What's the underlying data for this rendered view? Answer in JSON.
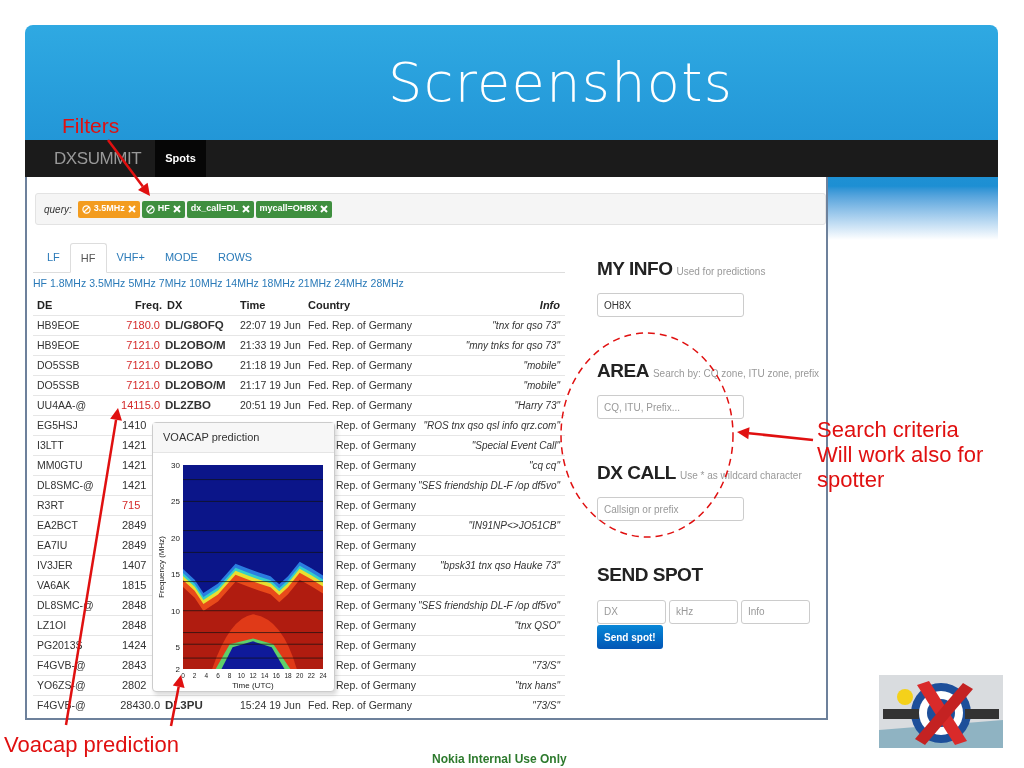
{
  "slide": {
    "title": "Screenshots",
    "filters_note": "Filters",
    "search_note": [
      "Search criteria",
      "Will work also for",
      "spotter"
    ],
    "voacap_note": "Voacap prediction",
    "footer": "Nokia Internal Use Only"
  },
  "app": {
    "brand": "DXSUMMIT",
    "nav": [
      {
        "label": "Spots",
        "selected": true
      }
    ],
    "query": {
      "label": "query:",
      "tags": [
        {
          "label": "3.5MHz",
          "color": "#f39c1f",
          "negated": true
        },
        {
          "label": "HF",
          "color": "#3f8f3f",
          "negated": true
        },
        {
          "label": "dx_call=DL",
          "color": "#3f8f3f",
          "negated": false
        },
        {
          "label": "mycall=OH8X",
          "color": "#3f8f3f",
          "negated": false
        }
      ]
    },
    "tabs": [
      {
        "label": "LF",
        "selected": false
      },
      {
        "label": "HF",
        "selected": true
      },
      {
        "label": "VHF+",
        "selected": false
      },
      {
        "label": "MODE",
        "selected": false
      },
      {
        "label": "ROWS",
        "selected": false
      }
    ],
    "bands": [
      "HF",
      "1.8MHz",
      "3.5MHz",
      "5MHz",
      "7MHz",
      "10MHz",
      "14MHz",
      "18MHz",
      "21MHz",
      "24MHz",
      "28MHz"
    ],
    "table": {
      "columns": [
        "DE",
        "Freq.",
        "DX",
        "Time",
        "Country",
        "Info"
      ],
      "rows": [
        {
          "de": "HB9EOE",
          "freq": "7180.0",
          "color": "#d42a2a",
          "covered": false,
          "dx": "DL/G8OFQ",
          "time": "22:07 19 Jun",
          "country": "Fed. Rep. of Germany",
          "info": "\"tnx for qso 73\""
        },
        {
          "de": "HB9EOE",
          "freq": "7121.0",
          "color": "#d42a2a",
          "covered": false,
          "dx": "DL2OBO/M",
          "time": "21:33 19 Jun",
          "country": "Fed. Rep. of Germany",
          "info": "\"mny tnks for qso 73\""
        },
        {
          "de": "DO5SSB",
          "freq": "7121.0",
          "color": "#d42a2a",
          "covered": false,
          "dx": "DL2OBO",
          "time": "21:18 19 Jun",
          "country": "Fed. Rep. of Germany",
          "info": "\"mobile\""
        },
        {
          "de": "DO5SSB",
          "freq": "7121.0",
          "color": "#d42a2a",
          "covered": false,
          "dx": "DL2OBO/M",
          "time": "21:17 19 Jun",
          "country": "Fed. Rep. of Germany",
          "info": "\"mobile\""
        },
        {
          "de": "UU4AA-@",
          "freq": "14115.0",
          "color": "#d42a2a",
          "covered": false,
          "dx": "DL2ZBO",
          "time": "20:51 19 Jun",
          "country": "Fed. Rep. of Germany",
          "info": "\"Harry 73\""
        },
        {
          "de": "EG5HSJ",
          "freq": "1410",
          "color": "#333333",
          "covered": true,
          "country": "Rep. of Germany",
          "info": "\"ROS tnx qso qsl info qrz.com\""
        },
        {
          "de": "I3LTT",
          "freq": "1421",
          "color": "#333333",
          "covered": true,
          "country": "Rep. of Germany",
          "info": "\"Special Event Call\""
        },
        {
          "de": "MM0GTU",
          "freq": "1421",
          "color": "#333333",
          "covered": true,
          "country": "Rep. of Germany",
          "info": "\"cq cq\""
        },
        {
          "de": "DL8SMC-@",
          "freq": "1421",
          "color": "#333333",
          "covered": true,
          "country": "Rep. of Germany",
          "info": "\"SES friendship DL-F /op df5vo\""
        },
        {
          "de": "R3RT",
          "freq": "715",
          "color": "#d42a2a",
          "covered": true,
          "country": "Rep. of Germany"
        },
        {
          "de": "EA2BCT",
          "freq": "2849",
          "color": "#333333",
          "covered": true,
          "country": "Rep. of Germany",
          "info": "\"IN91NP<>JO51CB\""
        },
        {
          "de": "EA7IU",
          "freq": "2849",
          "color": "#333333",
          "covered": true,
          "country": "Rep. of Germany"
        },
        {
          "de": "IV3JER",
          "freq": "1407",
          "color": "#333333",
          "covered": true,
          "country": "Rep. of Germany",
          "info": "\"bpsk31 tnx qso Hauke 73\""
        },
        {
          "de": "VA6AK",
          "freq": "1815",
          "color": "#333333",
          "covered": true,
          "country": "Rep. of Germany"
        },
        {
          "de": "DL8SMC-@",
          "freq": "2848",
          "color": "#333333",
          "covered": true,
          "country": "Rep. of Germany",
          "info": "\"SES friendship DL-F /op df5vo\""
        },
        {
          "de": "LZ1OI",
          "freq": "2848",
          "color": "#333333",
          "covered": true,
          "country": "Rep. of Germany",
          "info": "\"tnx QSO\""
        },
        {
          "de": "PG2013S",
          "freq": "1424",
          "color": "#333333",
          "covered": true,
          "country": "Rep. of Germany"
        },
        {
          "de": "F4GVB-@",
          "freq": "2843",
          "color": "#333333",
          "covered": true,
          "country": "Rep. of Germany",
          "info": "\"73/S\""
        },
        {
          "de": "YO6ZS-@",
          "freq": "2802",
          "color": "#333333",
          "covered": true,
          "country": "Rep. of Germany",
          "info": "\"tnx hans\""
        },
        {
          "de": "F4GVB-@",
          "freq": "28430.0",
          "color": "#333333",
          "covered": false,
          "dx": "DL3PU",
          "time": "15:24 19 Jun",
          "country": "Fed. Rep. of Germany",
          "info": "\"73/S\""
        }
      ]
    },
    "popover": {
      "title": "VOACAP prediction",
      "xlabel": "Time (UTC)",
      "ylabel": "Frequency (MHz)",
      "xticks": [
        "0",
        "2",
        "4",
        "6",
        "8",
        "10",
        "12",
        "14",
        "16",
        "18",
        "20",
        "22",
        "24"
      ],
      "yticks": [
        "30",
        "25",
        "20",
        "15",
        "10",
        "5",
        "2"
      ]
    },
    "sidebar": {
      "sections": [
        {
          "title": "MY INFO",
          "hint": "Used for predictions",
          "value": "OH8X"
        },
        {
          "title": "AREA",
          "hint": "Search by: CQ zone, ITU zone, prefix",
          "placeholder": "CQ, ITU, Prefix..."
        },
        {
          "title": "DX CALL",
          "hint": "Use * as wildcard character",
          "placeholder": "Callsign or prefix"
        }
      ],
      "send_spot": {
        "title": "SEND SPOT",
        "fields": [
          {
            "placeholder": "DX"
          },
          {
            "placeholder": "kHz"
          },
          {
            "placeholder": "Info"
          }
        ],
        "button": "Send spot!"
      }
    }
  }
}
